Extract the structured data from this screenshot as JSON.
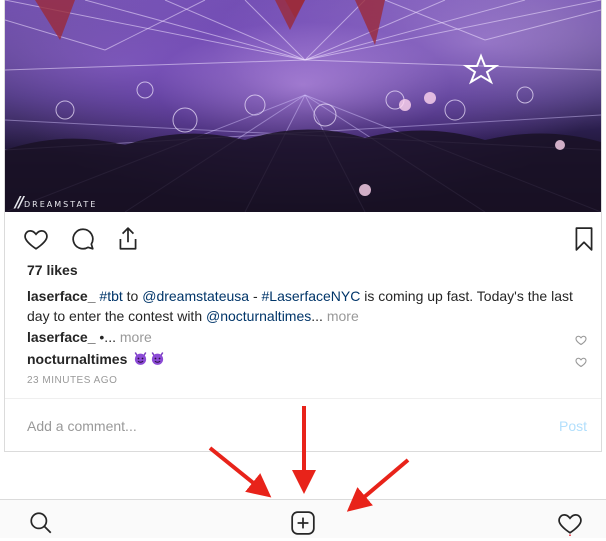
{
  "post": {
    "photo_watermark": "DREAMSTATE",
    "likes": "77 likes",
    "caption": {
      "username": "laserface_",
      "tag1": "#tbt",
      "to": " to ",
      "mention1": "@dreamstateusa",
      "dash": " - ",
      "tag2": "#LaserfaceNYC",
      "text1": " is coming up fast. Today's the last day to enter the contest with ",
      "mention2": "@nocturnaltimes",
      "ellipsis": "... ",
      "more": "more"
    },
    "comments": [
      {
        "username": "laserface_",
        "text": " •... ",
        "more": "more"
      },
      {
        "username": "nocturnaltimes",
        "text": ""
      }
    ],
    "timestamp": "23 MINUTES AGO",
    "comment_placeholder": "Add a comment...",
    "post_button": "Post"
  },
  "icons": {
    "like": "heart-icon",
    "comment": "comment-icon",
    "share": "share-icon",
    "save": "bookmark-icon",
    "nav": [
      "search-icon",
      "add-post-icon",
      "activity-heart-icon"
    ]
  },
  "colors": {
    "arrow": "#e8231a",
    "link": "#003569",
    "muted": "#999999",
    "post_button": "#b2dffc"
  }
}
